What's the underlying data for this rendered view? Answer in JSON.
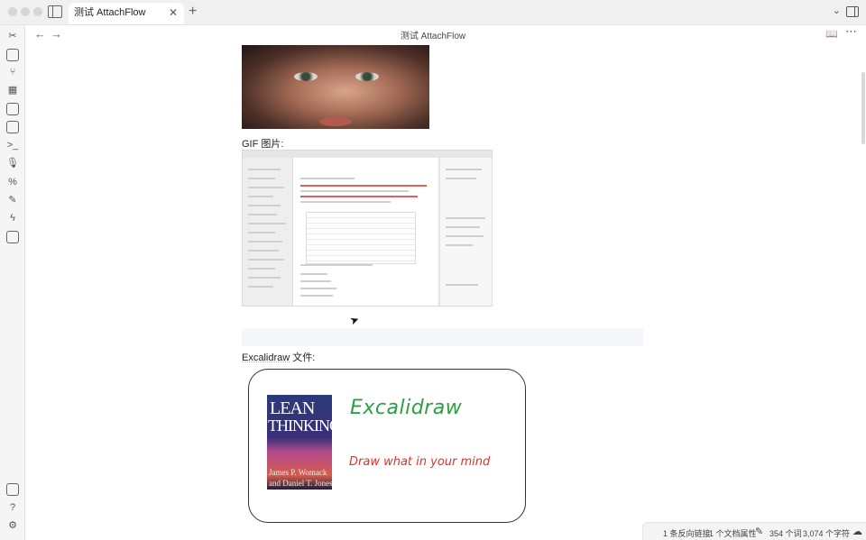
{
  "window": {
    "tab_title": "测试 AttachFlow",
    "tab_close_glyph": "✕",
    "new_tab_glyph": "+",
    "tab_list_glyph": "⌄"
  },
  "ribbon": {
    "icons": [
      "tools-icon",
      "new-note-icon",
      "graph-icon",
      "canvas-icon",
      "calendar-icon",
      "templates-icon",
      "terminal-icon",
      "microphone-icon",
      "percent-icon",
      "draw-icon",
      "bolt-icon",
      "clipboard-icon",
      "vault-icon",
      "help-icon",
      "settings-icon"
    ]
  },
  "header": {
    "back_glyph": "←",
    "forward_glyph": "→",
    "title": "测试 AttachFlow",
    "reading_glyph": "📖",
    "more_glyph": "⋯"
  },
  "content": {
    "gif_label": "GIF 图片:",
    "excalidraw_link": "Excalidraw",
    "excalidraw_suffix": " 文件:",
    "excalidraw_drawing": {
      "book_title_line1": "LEAN",
      "book_title_line2": "THINKING",
      "book_authors": "James P. Womack\nand Daniel T. Jones",
      "title": "Excalidraw",
      "tagline": "Draw what in your mind",
      "title_color": "#2f9e44",
      "tagline_color": "#e03131"
    }
  },
  "status_bar": {
    "backlinks": "1 条反向链接",
    "properties": "1 个文档属性",
    "edit_glyph": "✎",
    "words": "354 个词",
    "chars": "3,074 个字符",
    "sync_glyph": "☁"
  }
}
